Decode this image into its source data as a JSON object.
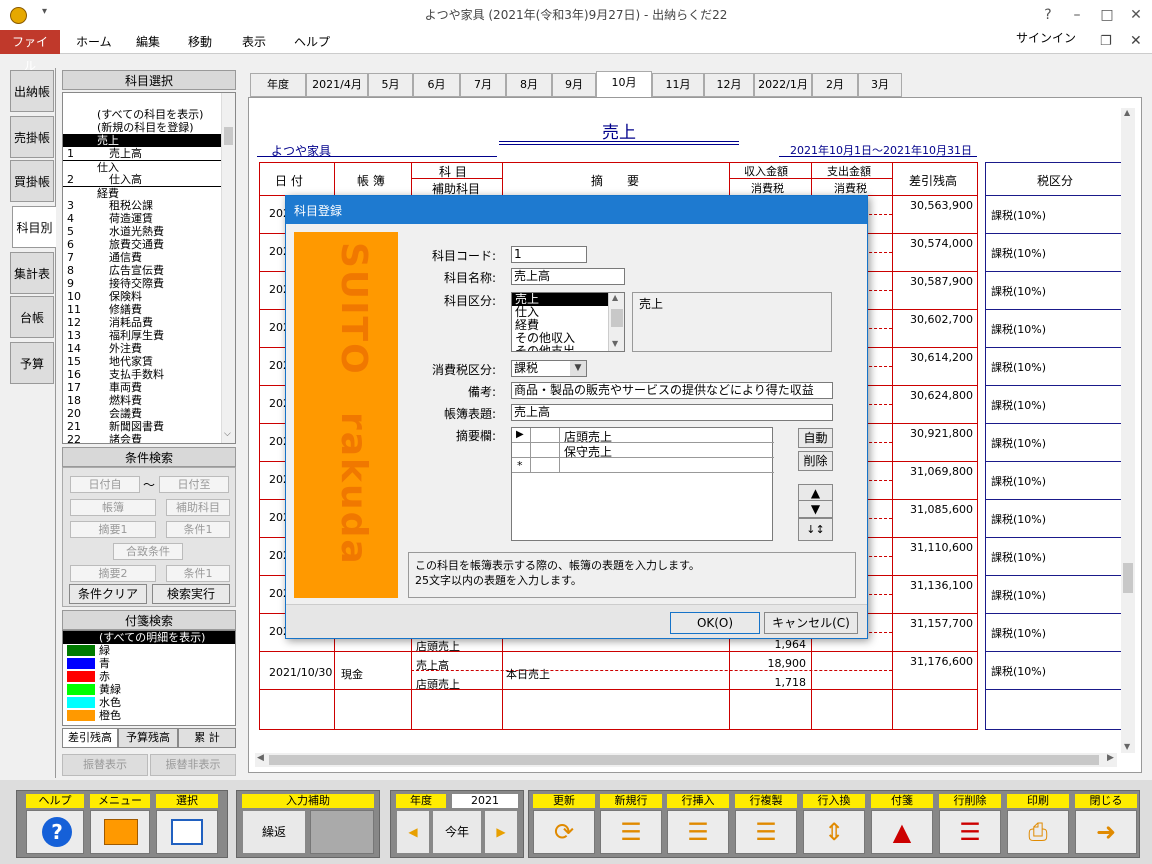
{
  "window": {
    "title": "よつや家具 (2021年(令和3年)9月27日) - 出納らくだ22"
  },
  "menu": {
    "file": "ファイル",
    "home": "ホーム",
    "edit": "編集",
    "move": "移動",
    "view": "表示",
    "help": "ヘルプ",
    "signin": "サインイン"
  },
  "vtabs": [
    "出納帳",
    "売掛帳",
    "買掛帳",
    "科目別",
    "集計表",
    "台帳",
    "予算"
  ],
  "subject_panel": {
    "title": "科目選択",
    "items": [
      {
        "code": "",
        "name": "(すべての科目を表示)",
        "indent": 1
      },
      {
        "code": "",
        "name": "(新規の科目を登録)",
        "indent": 1
      },
      {
        "code": "",
        "name": "売上",
        "indent": 0,
        "selected": true
      },
      {
        "code": "1",
        "name": "売上高",
        "indent": 2
      },
      {
        "code": "",
        "name": "仕入",
        "indent": 0
      },
      {
        "code": "2",
        "name": "仕入高",
        "indent": 2
      },
      {
        "code": "",
        "name": "経費",
        "indent": 0
      },
      {
        "code": "3",
        "name": "租税公課",
        "indent": 2
      },
      {
        "code": "4",
        "name": "荷造運賃",
        "indent": 2
      },
      {
        "code": "5",
        "name": "水道光熱費",
        "indent": 2
      },
      {
        "code": "6",
        "name": "旅費交通費",
        "indent": 2
      },
      {
        "code": "7",
        "name": "通信費",
        "indent": 2
      },
      {
        "code": "8",
        "name": "広告宣伝費",
        "indent": 2
      },
      {
        "code": "9",
        "name": "接待交際費",
        "indent": 2
      },
      {
        "code": "10",
        "name": "保険料",
        "indent": 2
      },
      {
        "code": "11",
        "name": "修繕費",
        "indent": 2
      },
      {
        "code": "12",
        "name": "消耗品費",
        "indent": 2
      },
      {
        "code": "13",
        "name": "福利厚生費",
        "indent": 2
      },
      {
        "code": "14",
        "name": "外注費",
        "indent": 2
      },
      {
        "code": "15",
        "name": "地代家賃",
        "indent": 2
      },
      {
        "code": "16",
        "name": "支払手数料",
        "indent": 2
      },
      {
        "code": "17",
        "name": "車両費",
        "indent": 2
      },
      {
        "code": "18",
        "name": "燃料費",
        "indent": 2
      },
      {
        "code": "20",
        "name": "会議費",
        "indent": 2
      },
      {
        "code": "21",
        "name": "新聞図書費",
        "indent": 2
      },
      {
        "code": "22",
        "name": "諸会費",
        "indent": 2
      }
    ]
  },
  "search_panel": {
    "title": "条件検索",
    "date_from": "日付自",
    "tilde": "～",
    "date_to": "日付至",
    "ledger": "帳簿",
    "sub_subject": "補助科目",
    "memo1": "摘要1",
    "cond1": "条件1",
    "match": "合致条件",
    "memo2": "摘要2",
    "cond2": "条件1",
    "clear": "条件クリア",
    "run": "検索実行"
  },
  "tag_panel": {
    "title": "付箋検索",
    "items": [
      {
        "name": "(すべての明細を表示)",
        "color": ""
      },
      {
        "name": "緑",
        "color": "#007a00"
      },
      {
        "name": "青",
        "color": "#0000ff"
      },
      {
        "name": "赤",
        "color": "#ff0000"
      },
      {
        "name": "黄緑",
        "color": "#00ff00"
      },
      {
        "name": "水色",
        "color": "#00ffff"
      },
      {
        "name": "橙色",
        "color": "#ff9900"
      }
    ]
  },
  "bottom_tabs": [
    "差引残高",
    "予算残高",
    "累 計"
  ],
  "transfer": {
    "show": "振替表示",
    "hide": "振替非表示"
  },
  "month_tabs": [
    "年度",
    "2021/4月",
    "5月",
    "6月",
    "7月",
    "8月",
    "9月",
    "10月",
    "11月",
    "12月",
    "2022/1月",
    "2月",
    "3月"
  ],
  "ledger": {
    "title": "売上",
    "company": "よつや家具",
    "period": "2021年10月1日～2021年10月31日",
    "headers": {
      "date": "日 付",
      "book": "帳 簿",
      "subject": "科 目",
      "sub": "補助科目",
      "memo": "摘　　要",
      "income": "収入金額",
      "tax": "消費税",
      "expense": "支出金額",
      "tax2": "消費税",
      "balance": "差引残高",
      "taxcat": "税区分"
    },
    "balances": [
      "30,563,900",
      "30,574,000",
      "30,587,900",
      "30,602,700",
      "30,614,200",
      "30,624,800",
      "30,921,800",
      "31,069,800",
      "31,085,600",
      "31,110,600",
      "31,136,100",
      "31,157,700",
      "31,176,600"
    ],
    "taxcats": [
      "課税(10%)",
      "課税(10%)",
      "課税(10%)",
      "課税(10%)",
      "課税(10%)",
      "課税(10%)",
      "課税(10%)",
      "課税(10%)",
      "課税(10%)",
      "課税(10%)",
      "課税(10%)",
      "課税(10%)",
      "課税(10%)"
    ],
    "date_prefix": "202",
    "row12_sub": "店頭売上",
    "row12_tax": "1,964",
    "last_row": {
      "date": "2021/10/30",
      "book": "現金",
      "subject": "売上高",
      "sub": "店頭売上",
      "memo": "本日売上",
      "income": "18,900",
      "tax": "1,718"
    }
  },
  "dialog": {
    "title": "科目登録",
    "brand_top": "SUITO",
    "brand_bottom": "rakuda",
    "code_label": "科目コード:",
    "code": "1",
    "name_label": "科目名称:",
    "name": "売上高",
    "cat_label": "科目区分:",
    "cats": [
      "売上",
      "仕入",
      "経費",
      "その他収入",
      "その他支出"
    ],
    "cat_selected": "売上",
    "taxcat_label": "消費税区分:",
    "taxcat": "課税",
    "note_label": "備考:",
    "note": "商品・製品の販売やサービスの提供などにより得た収益",
    "booktitle_label": "帳簿表題:",
    "booktitle": "売上高",
    "memo_label": "摘要欄:",
    "memos": [
      "店頭売上",
      "保守売上"
    ],
    "auto": "自動",
    "delete": "削除",
    "hint1": "この科目を帳簿表示する際の、帳簿の表題を入力します。",
    "hint2": "25文字以内の表題を入力します。",
    "ok": "OK(O)",
    "cancel": "キャンセル(C)"
  },
  "toolbar": {
    "help": "ヘルプ",
    "menu": "メニュー",
    "select": "選択",
    "input_assist": "入力補助",
    "repeat": "繰返",
    "fiscal_year": "年度",
    "year": "2021",
    "this_year": "今年",
    "update": "更新",
    "new_row": "新規行",
    "insert_row": "行挿入",
    "copy_row": "行複製",
    "swap_row": "行入換",
    "tag": "付箋",
    "delete_row": "行削除",
    "print": "印刷",
    "close": "閉じる"
  }
}
